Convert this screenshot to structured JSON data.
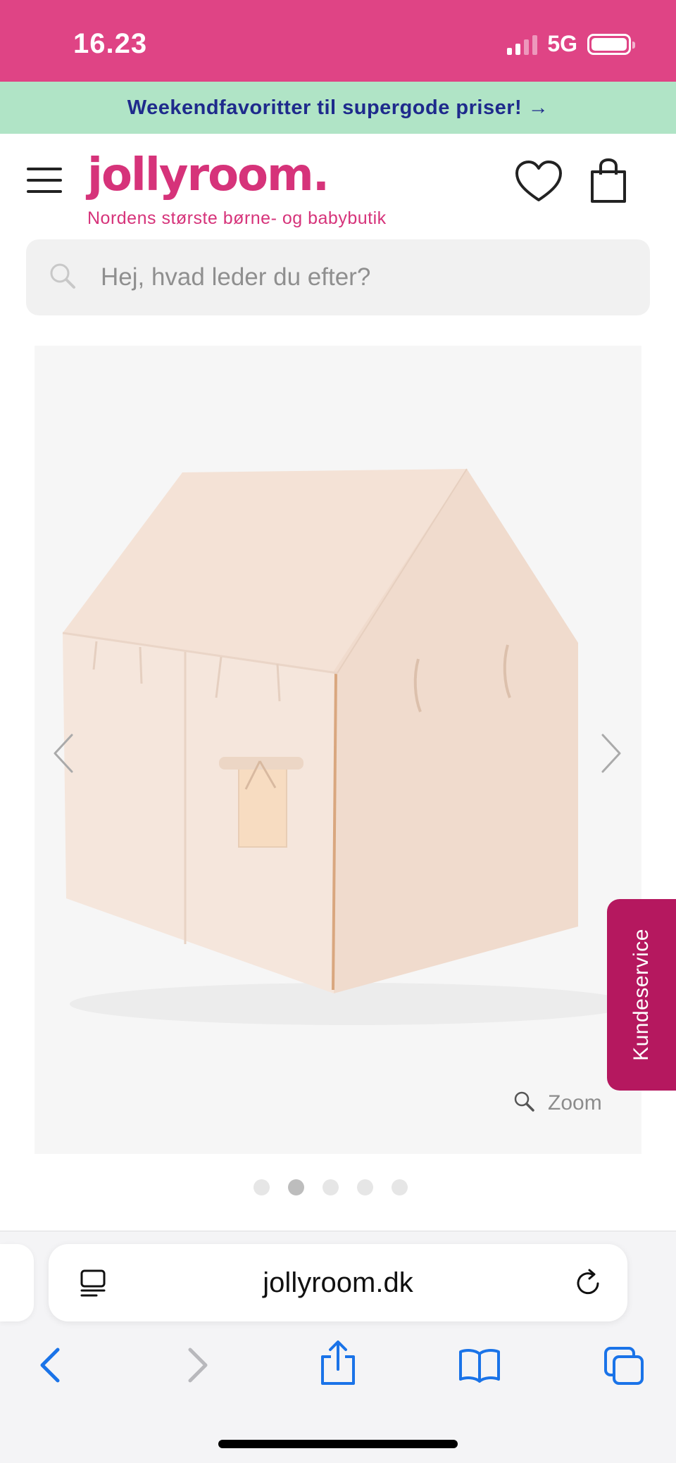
{
  "status_bar": {
    "time": "16.23",
    "network": "5G"
  },
  "promo": {
    "text": "Weekendfavoritter til supergode priser! →"
  },
  "header": {
    "logo": "jollyroom.",
    "tagline": "Nordens største børne- og babybutik"
  },
  "search": {
    "placeholder": "Hej, hvad leder du efter?"
  },
  "gallery": {
    "zoom_label": "Zoom",
    "dots": [
      false,
      true,
      false,
      false,
      false
    ]
  },
  "support": {
    "label": "Kundeservice"
  },
  "browser": {
    "url": "jollyroom.dk"
  },
  "colors": {
    "status_bar": "#df4485",
    "promo_bg": "#b0e4c6",
    "promo_text": "#1e2a8c",
    "brand": "#d6337a",
    "support_tab": "#b5185f",
    "ios_blue": "#1a73e8"
  }
}
